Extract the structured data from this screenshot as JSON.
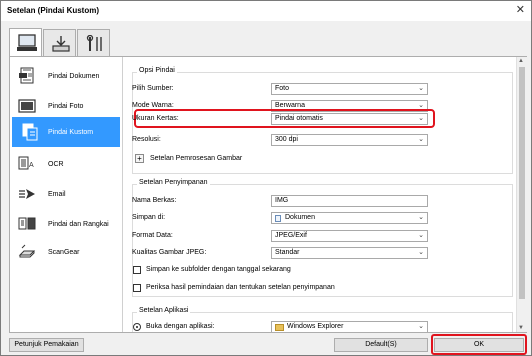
{
  "window": {
    "title": "Setelan (Pindai Kustom)"
  },
  "tabs": [
    {
      "icon": "scan-from-computer-icon",
      "active": true
    },
    {
      "icon": "scan-from-operation-panel-icon",
      "active": false
    },
    {
      "icon": "general-settings-tools-icon",
      "active": false
    }
  ],
  "sidebar": {
    "items": [
      {
        "label": "Pindai Dokumen",
        "icon": "document-icon"
      },
      {
        "label": "Pindai Foto",
        "icon": "photo-icon"
      },
      {
        "label": "Pindai Kustom",
        "icon": "custom-scan-icon",
        "active": true
      },
      {
        "label": "OCR",
        "icon": "ocr-icon"
      },
      {
        "label": "Email",
        "icon": "email-icon"
      },
      {
        "label": "Pindai dan Rangkai",
        "icon": "stitch-icon"
      },
      {
        "label": "ScanGear",
        "icon": "scangear-icon"
      }
    ]
  },
  "scan_options": {
    "title": "Opsi Pindai",
    "source_label": "Pilih Sumber:",
    "source_value": "Foto",
    "color_label": "Mode Warna:",
    "color_value": "Berwarna",
    "paper_label": "Ukuran Kertas:",
    "paper_value": "Pindai otomatis",
    "resolution_label": "Resolusi:",
    "resolution_value": "300 dpi",
    "image_processing_label": "Setelan Pemrosesan Gambar"
  },
  "save_settings": {
    "title": "Setelan Penyimpanan",
    "filename_label": "Nama Berkas:",
    "filename_value": "IMG",
    "savein_label": "Simpan di:",
    "savein_value": "Dokumen",
    "format_label": "Format Data:",
    "format_value": "JPEG/Exif",
    "quality_label": "Kualitas Gambar JPEG:",
    "quality_value": "Standar",
    "subfolder_label": "Simpan ke subfolder dengan tanggal sekarang",
    "check_results_label": "Periksa hasil pemindaian dan tentukan setelan penyimpanan"
  },
  "app_settings": {
    "title": "Setelan Aplikasi",
    "open_with_label": "Buka dengan aplikasi:",
    "open_with_value": "Windows Explorer"
  },
  "footer": {
    "help_label": "Petunjuk Pemakaian",
    "default_label": "Default(S)",
    "ok_label": "OK"
  },
  "colors": {
    "accent": "#3399ff",
    "highlight": "#e0141e"
  }
}
